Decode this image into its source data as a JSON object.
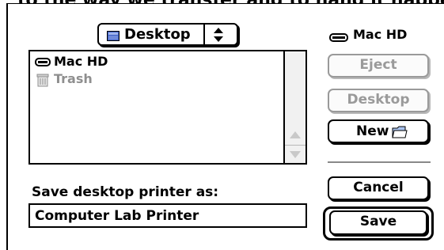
{
  "background_partial_text": "to the way we transfer and to hand it happened",
  "location_popup": {
    "label": "Desktop",
    "icon": "desktop-folder-icon"
  },
  "volume": {
    "label": "Mac HD",
    "icon": "hard-drive-icon"
  },
  "file_list": {
    "items": [
      {
        "label": "Mac HD",
        "icon": "hard-drive-icon",
        "enabled": true
      },
      {
        "label": "Trash",
        "icon": "trash-icon",
        "enabled": false
      }
    ]
  },
  "buttons": {
    "eject": {
      "label": "Eject",
      "enabled": false
    },
    "desktop": {
      "label": "Desktop",
      "enabled": false
    },
    "new": {
      "label": "New",
      "icon": "new-folder-icon",
      "enabled": true
    },
    "cancel": {
      "label": "Cancel",
      "enabled": true
    },
    "save": {
      "label": "Save",
      "enabled": true,
      "default": true
    }
  },
  "save_prompt": "Save desktop printer as:",
  "filename": {
    "value": "Computer Lab Printer"
  }
}
